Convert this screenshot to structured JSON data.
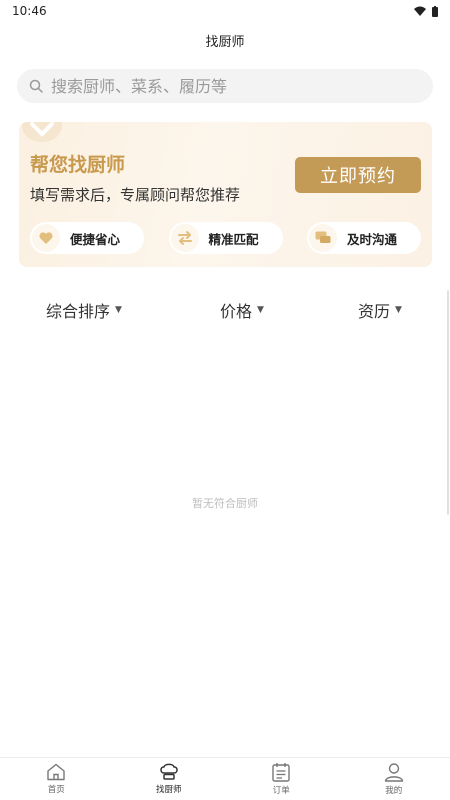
{
  "status_bar": {
    "time": "10:46"
  },
  "header": {
    "title": "找厨师"
  },
  "search": {
    "placeholder": "搜索厨师、菜系、履历等"
  },
  "banner": {
    "title": "帮您找厨师",
    "subtitle": "填写需求后，专属顾问帮您推荐",
    "book_button": "立即预约",
    "features": [
      {
        "label": "便捷省心",
        "icon": "heart-icon"
      },
      {
        "label": "精准匹配",
        "icon": "swap-arrows-icon"
      },
      {
        "label": "及时沟通",
        "icon": "chat-icon"
      }
    ]
  },
  "sort_bar": {
    "items": [
      {
        "label": "综合排序"
      },
      {
        "label": "价格"
      },
      {
        "label": "资历"
      }
    ]
  },
  "empty_text": "暂无符合厨师",
  "tabs": [
    {
      "label": "首页",
      "icon": "home-icon"
    },
    {
      "label": "找厨师",
      "icon": "chef-hat-icon",
      "active": true
    },
    {
      "label": "订单",
      "icon": "order-list-icon"
    },
    {
      "label": "我的",
      "icon": "user-icon"
    }
  ],
  "colors": {
    "accent": "#c49a57",
    "title_gold": "#c9994d",
    "banner_bg": "#fbf0e1"
  }
}
